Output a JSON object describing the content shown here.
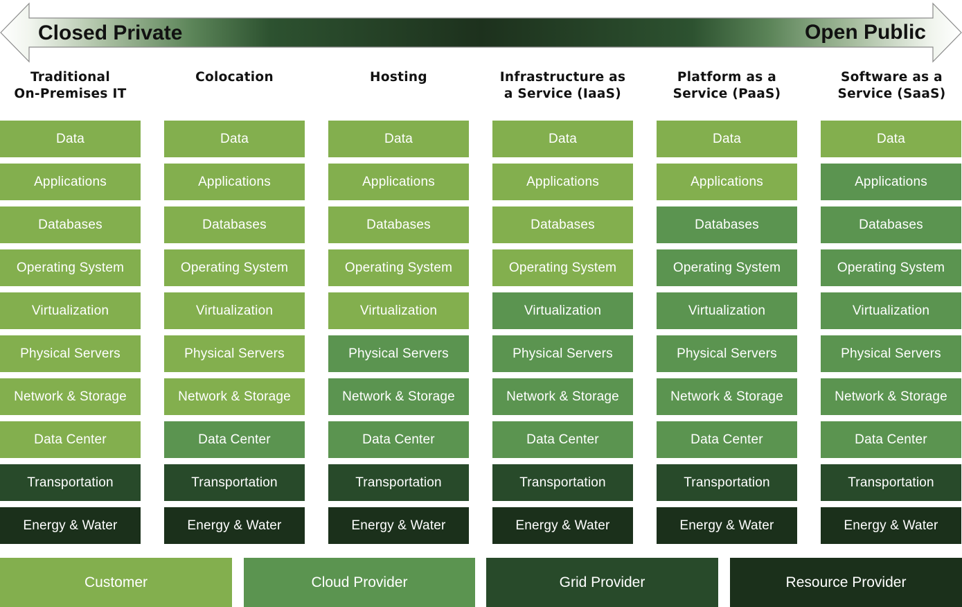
{
  "spectrum": {
    "left_label": "Closed Private",
    "right_label": "Open Public"
  },
  "colors": {
    "customer": "#83af4e",
    "cloud_provider": "#5b9450",
    "grid_provider": "#284a2a",
    "resource_provider": "#1b301b"
  },
  "columns": [
    {
      "title": "Traditional\nOn-Premises IT",
      "layers": [
        {
          "label": "Data",
          "owner": "customer"
        },
        {
          "label": "Applications",
          "owner": "customer"
        },
        {
          "label": "Databases",
          "owner": "customer"
        },
        {
          "label": "Operating System",
          "owner": "customer"
        },
        {
          "label": "Virtualization",
          "owner": "customer"
        },
        {
          "label": "Physical Servers",
          "owner": "customer"
        },
        {
          "label": "Network & Storage",
          "owner": "customer"
        },
        {
          "label": "Data Center",
          "owner": "customer"
        },
        {
          "label": "Transportation",
          "owner": "grid_provider"
        },
        {
          "label": "Energy & Water",
          "owner": "resource_provider"
        }
      ]
    },
    {
      "title": "Colocation",
      "layers": [
        {
          "label": "Data",
          "owner": "customer"
        },
        {
          "label": "Applications",
          "owner": "customer"
        },
        {
          "label": "Databases",
          "owner": "customer"
        },
        {
          "label": "Operating System",
          "owner": "customer"
        },
        {
          "label": "Virtualization",
          "owner": "customer"
        },
        {
          "label": "Physical Servers",
          "owner": "customer"
        },
        {
          "label": "Network & Storage",
          "owner": "customer"
        },
        {
          "label": "Data Center",
          "owner": "cloud_provider"
        },
        {
          "label": "Transportation",
          "owner": "grid_provider"
        },
        {
          "label": "Energy & Water",
          "owner": "resource_provider"
        }
      ]
    },
    {
      "title": "Hosting",
      "layers": [
        {
          "label": "Data",
          "owner": "customer"
        },
        {
          "label": "Applications",
          "owner": "customer"
        },
        {
          "label": "Databases",
          "owner": "customer"
        },
        {
          "label": "Operating System",
          "owner": "customer"
        },
        {
          "label": "Virtualization",
          "owner": "customer"
        },
        {
          "label": "Physical Servers",
          "owner": "cloud_provider"
        },
        {
          "label": "Network & Storage",
          "owner": "cloud_provider"
        },
        {
          "label": "Data Center",
          "owner": "cloud_provider"
        },
        {
          "label": "Transportation",
          "owner": "grid_provider"
        },
        {
          "label": "Energy & Water",
          "owner": "resource_provider"
        }
      ]
    },
    {
      "title": "Infrastructure as\na Service (IaaS)",
      "layers": [
        {
          "label": "Data",
          "owner": "customer"
        },
        {
          "label": "Applications",
          "owner": "customer"
        },
        {
          "label": "Databases",
          "owner": "customer"
        },
        {
          "label": "Operating System",
          "owner": "customer"
        },
        {
          "label": "Virtualization",
          "owner": "cloud_provider"
        },
        {
          "label": "Physical Servers",
          "owner": "cloud_provider"
        },
        {
          "label": "Network & Storage",
          "owner": "cloud_provider"
        },
        {
          "label": "Data Center",
          "owner": "cloud_provider"
        },
        {
          "label": "Transportation",
          "owner": "grid_provider"
        },
        {
          "label": "Energy & Water",
          "owner": "resource_provider"
        }
      ]
    },
    {
      "title": "Platform as a\nService (PaaS)",
      "layers": [
        {
          "label": "Data",
          "owner": "customer"
        },
        {
          "label": "Applications",
          "owner": "customer"
        },
        {
          "label": "Databases",
          "owner": "cloud_provider"
        },
        {
          "label": "Operating System",
          "owner": "cloud_provider"
        },
        {
          "label": "Virtualization",
          "owner": "cloud_provider"
        },
        {
          "label": "Physical Servers",
          "owner": "cloud_provider"
        },
        {
          "label": "Network & Storage",
          "owner": "cloud_provider"
        },
        {
          "label": "Data Center",
          "owner": "cloud_provider"
        },
        {
          "label": "Transportation",
          "owner": "grid_provider"
        },
        {
          "label": "Energy & Water",
          "owner": "resource_provider"
        }
      ]
    },
    {
      "title": "Software as a\nService (SaaS)",
      "layers": [
        {
          "label": "Data",
          "owner": "customer"
        },
        {
          "label": "Applications",
          "owner": "cloud_provider"
        },
        {
          "label": "Databases",
          "owner": "cloud_provider"
        },
        {
          "label": "Operating System",
          "owner": "cloud_provider"
        },
        {
          "label": "Virtualization",
          "owner": "cloud_provider"
        },
        {
          "label": "Physical Servers",
          "owner": "cloud_provider"
        },
        {
          "label": "Network & Storage",
          "owner": "cloud_provider"
        },
        {
          "label": "Data Center",
          "owner": "cloud_provider"
        },
        {
          "label": "Transportation",
          "owner": "grid_provider"
        },
        {
          "label": "Energy & Water",
          "owner": "resource_provider"
        }
      ]
    }
  ],
  "legend": [
    {
      "label": "Customer",
      "owner": "customer"
    },
    {
      "label": "Cloud Provider",
      "owner": "cloud_provider"
    },
    {
      "label": "Grid Provider",
      "owner": "grid_provider"
    },
    {
      "label": "Resource Provider",
      "owner": "resource_provider"
    }
  ]
}
